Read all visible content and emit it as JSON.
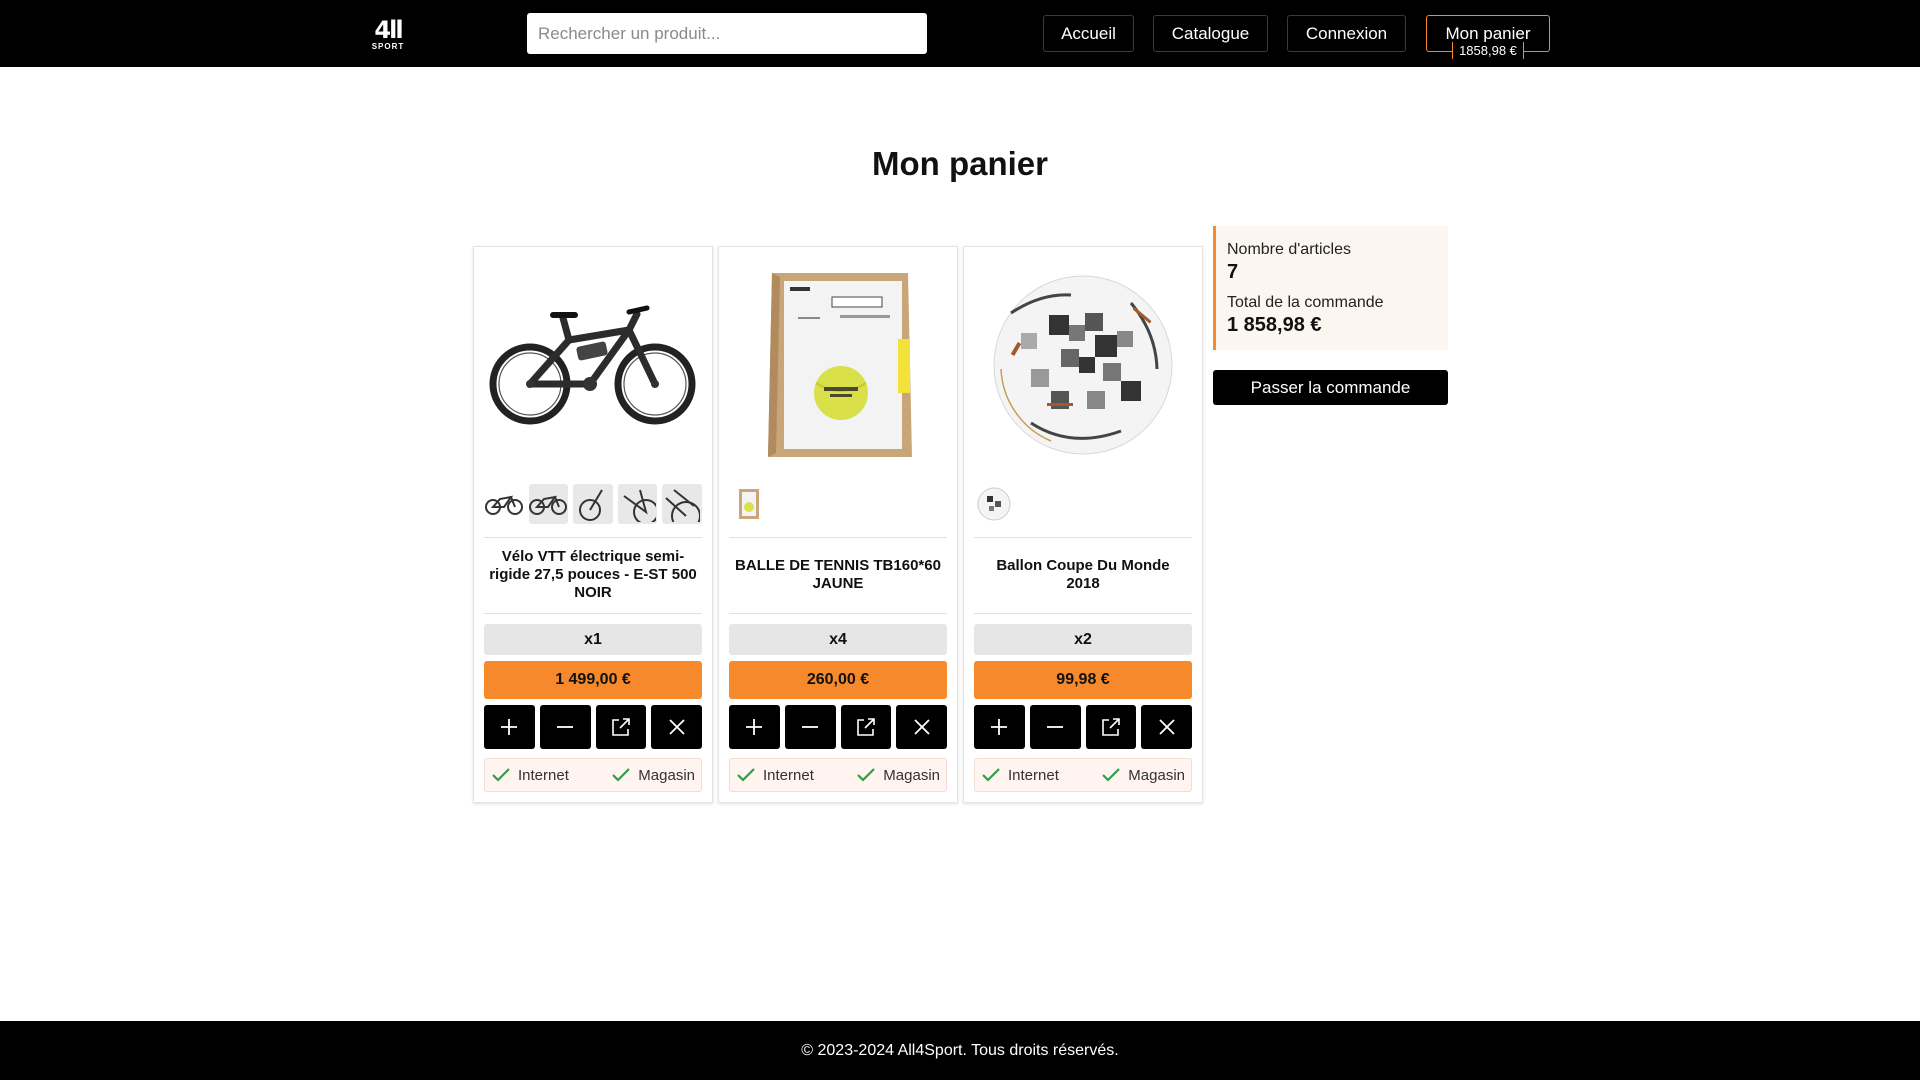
{
  "header": {
    "logo": {
      "big": "4ll",
      "small": "SPORT"
    },
    "search_placeholder": "Rechercher un produit...",
    "nav": {
      "home": "Accueil",
      "catalog": "Catalogue",
      "login": "Connexion",
      "cart": "Mon panier",
      "cart_total": "1858,98 €"
    }
  },
  "page_title": "Mon panier",
  "products": [
    {
      "name": "Vélo VTT électrique semi-rigide 27,5 pouces - E-ST 500 NOIR",
      "quantity": "x1",
      "price": "1 499,00 €",
      "image": "bike-image",
      "thumbnails": 5,
      "availability": {
        "internet": "Internet",
        "store": "Magasin"
      }
    },
    {
      "name": "BALLE DE TENNIS TB160*60 JAUNE",
      "quantity": "x4",
      "price": "260,00 €",
      "image": "tennis-ball-box-image",
      "thumbnails": 1,
      "availability": {
        "internet": "Internet",
        "store": "Magasin"
      }
    },
    {
      "name": "Ballon Coupe Du Monde 2018",
      "quantity": "x2",
      "price": "99,98 €",
      "image": "soccer-ball-image",
      "thumbnails": 1,
      "availability": {
        "internet": "Internet",
        "store": "Magasin"
      }
    }
  ],
  "summary": {
    "items_label": "Nombre d'articles",
    "items_count": "7",
    "total_label": "Total de la commande",
    "total_value": "1 858,98 €",
    "order_button": "Passer la commande"
  },
  "footer": {
    "copyright": "© 2023-2024 All4Sport. Tous droits réservés."
  },
  "icons": {
    "increase": "plus-icon",
    "decrease": "minus-icon",
    "open": "external-link-icon",
    "remove": "close-icon",
    "available": "check-icon"
  },
  "colors": {
    "accent": "#f5892b",
    "header_bg": "#000000",
    "check": "#2e9e44",
    "summary_bg": "#fcf6f0"
  }
}
